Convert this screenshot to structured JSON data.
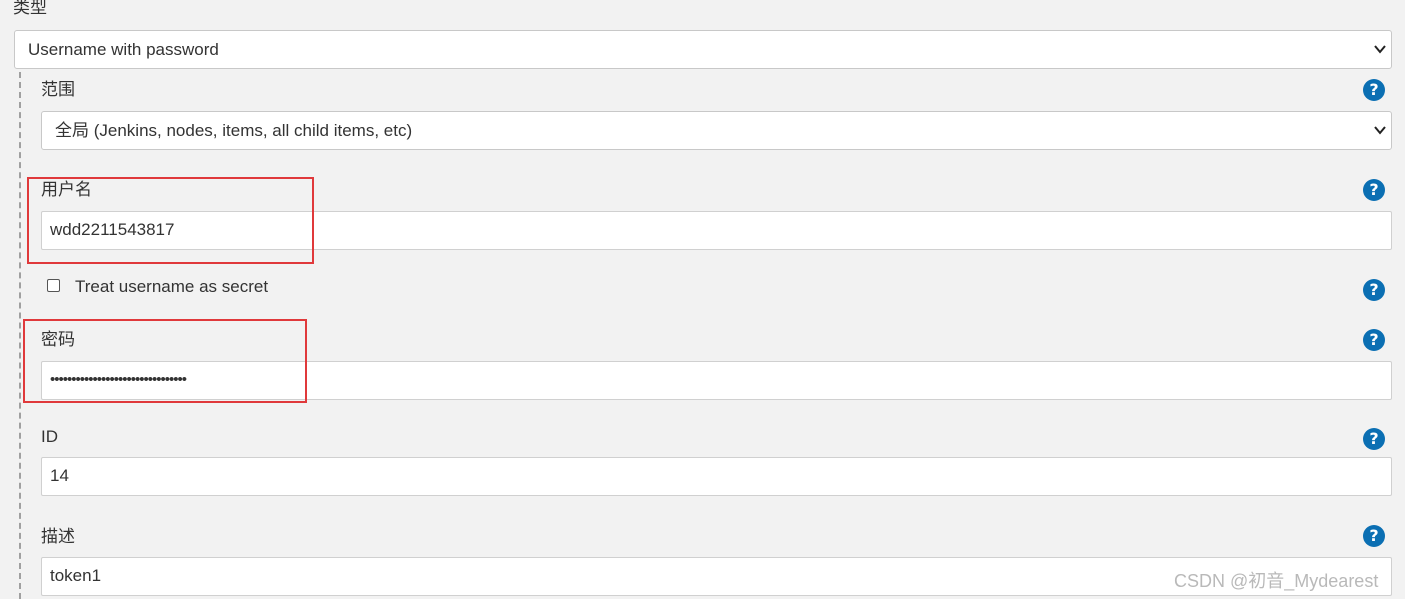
{
  "kind": {
    "label": "类型",
    "selected": "Username with password"
  },
  "scope": {
    "label": "范围",
    "selected": "全局 (Jenkins, nodes, items, all child items, etc)"
  },
  "username": {
    "label": "用户名",
    "value": "wdd2211543817"
  },
  "treat_secret": {
    "label": "Treat username as secret",
    "checked": false
  },
  "password": {
    "label": "密码",
    "masked_value": "••••••••••••••••••••••••••••••••"
  },
  "id": {
    "label": "ID",
    "value": "14"
  },
  "description": {
    "label": "描述",
    "value": "token1"
  },
  "help_glyph": "?",
  "watermark": "CSDN @初音_Mydearest",
  "colors": {
    "help_icon": "#0b6fb3",
    "highlight_box": "#e0393b",
    "background": "#f2f2f2"
  }
}
